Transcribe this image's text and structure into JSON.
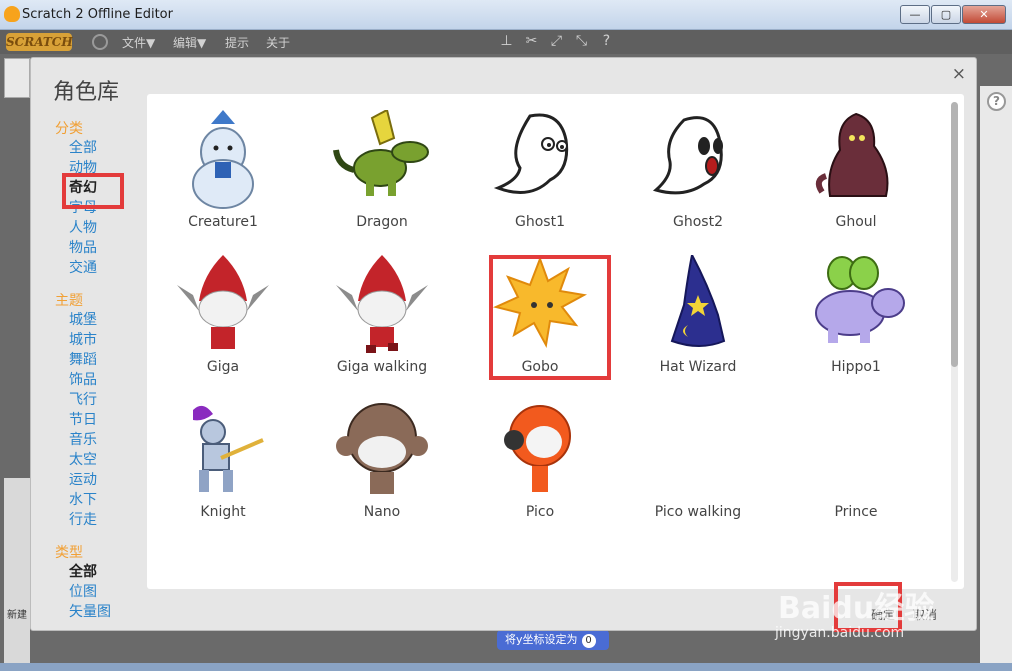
{
  "window": {
    "title": "Scratch 2 Offline Editor",
    "min": "—",
    "max": "▢",
    "close": "✕"
  },
  "menubar": {
    "logo": "SCRATCH",
    "file": "文件▼",
    "edit": "编辑▼",
    "tips": "提示",
    "about": "关于"
  },
  "dialog": {
    "title": "角色库",
    "close": "×",
    "filters": {
      "category_title": "分类",
      "categories": [
        "全部",
        "动物",
        "奇幻",
        "字母",
        "人物",
        "物品",
        "交通"
      ],
      "theme_title": "主题",
      "themes": [
        "城堡",
        "城市",
        "舞蹈",
        "饰品",
        "飞行",
        "节日",
        "音乐",
        "太空",
        "运动",
        "水下",
        "行走"
      ],
      "type_title": "类型",
      "types": [
        "全部",
        "位图",
        "矢量图"
      ]
    },
    "sprites": [
      "Creature1",
      "Dragon",
      "Ghost1",
      "Ghost2",
      "Ghoul",
      "Giga",
      "Giga walking",
      "Gobo",
      "Hat Wizard",
      "Hippo1",
      "Knight",
      "Nano",
      "Pico",
      "Pico walking",
      "Prince"
    ],
    "ok": "确定",
    "cancel": "取消"
  },
  "background": {
    "new_label": "新建",
    "block_text": "将y坐标设定为",
    "block_value": "0"
  },
  "watermark": {
    "brand": "Baidu经验",
    "url": "jingyan.baidu.com"
  },
  "colors": {
    "highlight": "#e33b3b",
    "category_title": "#f1a035",
    "link": "#2a83c9"
  }
}
